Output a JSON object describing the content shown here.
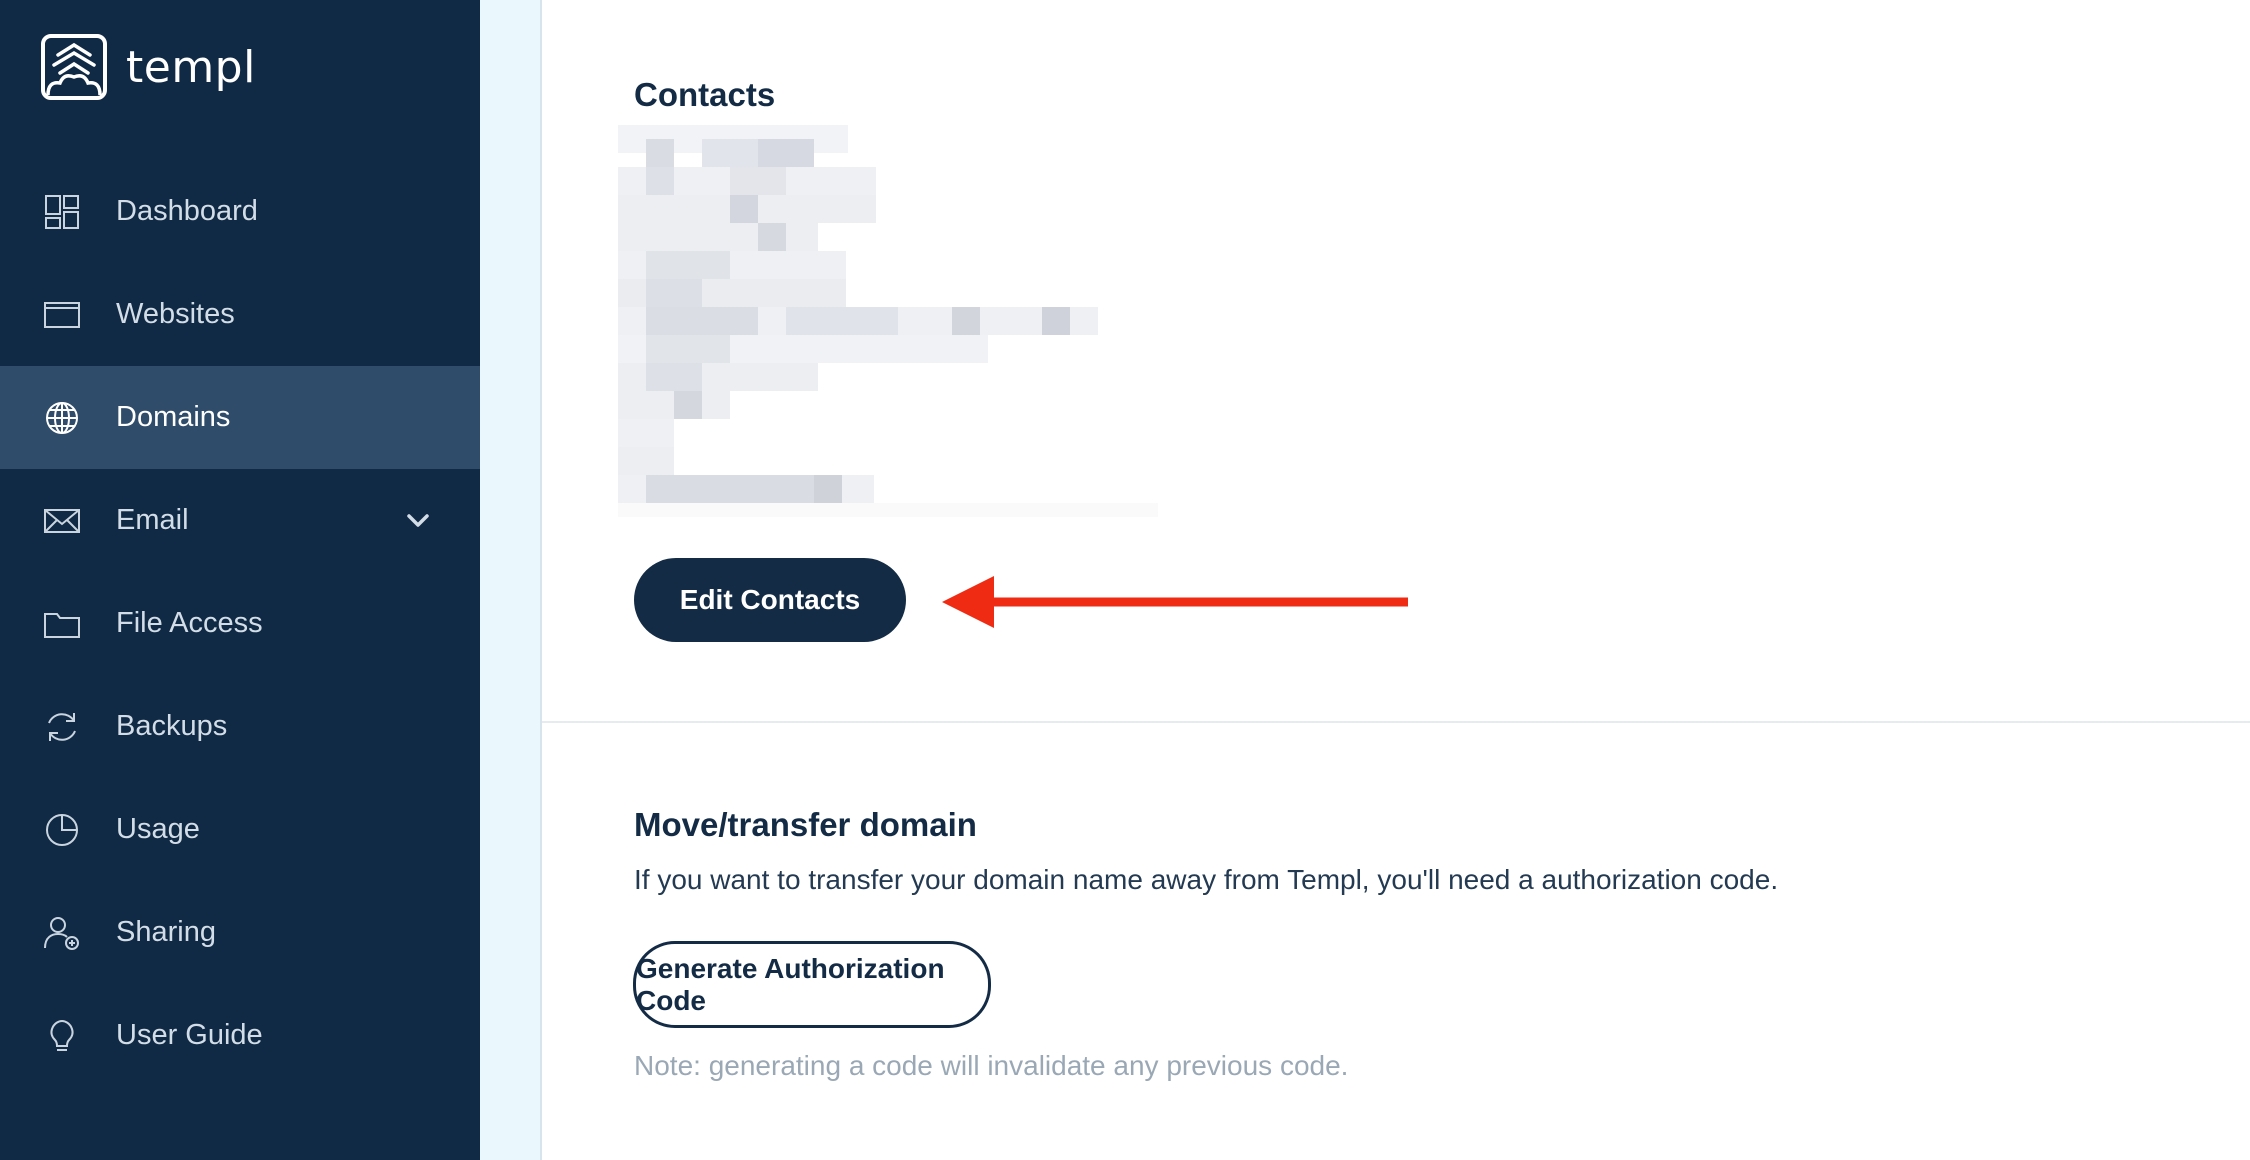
{
  "app": {
    "brand_name": "templ"
  },
  "sidebar": {
    "items": [
      {
        "label": "Dashboard",
        "icon": "dashboard-icon",
        "active": false
      },
      {
        "label": "Websites",
        "icon": "browser-window-icon",
        "active": false
      },
      {
        "label": "Domains",
        "icon": "globe-icon",
        "active": true
      },
      {
        "label": "Email",
        "icon": "envelope-icon",
        "active": false,
        "expandable": true
      },
      {
        "label": "File Access",
        "icon": "folder-icon",
        "active": false
      },
      {
        "label": "Backups",
        "icon": "refresh-icon",
        "active": false
      },
      {
        "label": "Usage",
        "icon": "pie-chart-icon",
        "active": false
      },
      {
        "label": "Sharing",
        "icon": "user-add-icon",
        "active": false
      },
      {
        "label": "User Guide",
        "icon": "lightbulb-icon",
        "active": false
      }
    ]
  },
  "contacts": {
    "title": "Contacts",
    "edit_button_label": "Edit Contacts"
  },
  "transfer": {
    "title": "Move/transfer domain",
    "description": "If you want to transfer your domain name away from Templ, you'll need a authorization code.",
    "button_label": "Generate Authorization Code",
    "note": "Note: generating a code will invalidate any previous code."
  },
  "colors": {
    "sidebar_bg": "#102a45",
    "sidebar_active": "#2f4c6a",
    "primary": "#132b45",
    "annotation_arrow": "#f02b14",
    "note_text": "#9aa8b6"
  }
}
